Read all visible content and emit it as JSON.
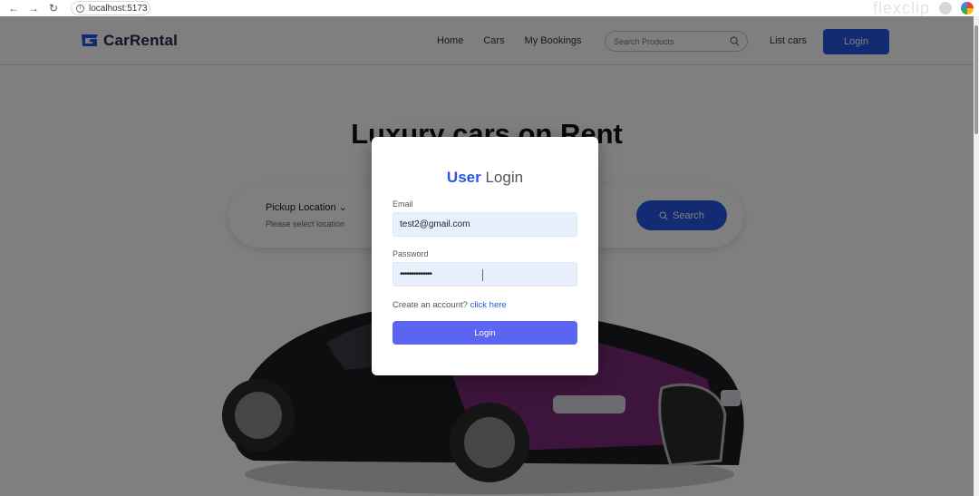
{
  "browser": {
    "url": "localhost:5173",
    "watermark": "flexclip"
  },
  "brand": {
    "name": "CarRental",
    "accent_color": "#2556e6"
  },
  "nav": {
    "links": [
      "Home",
      "Cars",
      "My Bookings"
    ],
    "search_placeholder": "Search Products",
    "list_cars": "List cars",
    "login": "Login"
  },
  "hero": {
    "title": "Luxury cars on Rent",
    "pickup_label": "Pickup Location",
    "pickup_sub": "Please select location",
    "search_button": "Search"
  },
  "modal": {
    "title_accent": "User",
    "title_rest": "Login",
    "email_label": "Email",
    "email_value": "test2@gmail.com",
    "password_label": "Password",
    "password_value": "••••••••••••••",
    "signup_prefix": "Create an account?",
    "signup_link": "click here",
    "submit": "Login",
    "submit_color": "#5c64f2"
  }
}
